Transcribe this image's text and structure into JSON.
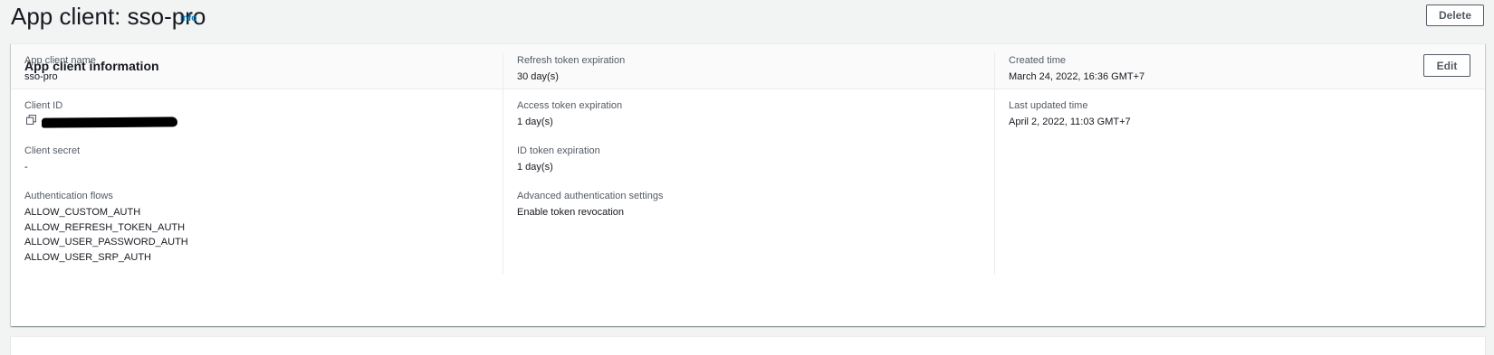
{
  "header": {
    "title": "App client: sso-pro",
    "info_label": "Info",
    "delete_label": "Delete"
  },
  "panel": {
    "title": "App client information",
    "edit_label": "Edit",
    "col1": {
      "app_client_name_label": "App client name",
      "app_client_name": "sso-pro",
      "client_id_label": "Client ID",
      "client_secret_label": "Client secret",
      "client_secret": "-",
      "auth_flows_label": "Authentication flows",
      "auth_flows": [
        "ALLOW_CUSTOM_AUTH",
        "ALLOW_REFRESH_TOKEN_AUTH",
        "ALLOW_USER_PASSWORD_AUTH",
        "ALLOW_USER_SRP_AUTH"
      ]
    },
    "col2": {
      "refresh_label": "Refresh token expiration",
      "refresh_value": "30 day(s)",
      "access_label": "Access token expiration",
      "access_value": "1 day(s)",
      "id_label": "ID token expiration",
      "id_value": "1 day(s)",
      "advanced_label": "Advanced authentication settings",
      "advanced_value": "Enable token revocation"
    },
    "col3": {
      "created_label": "Created time",
      "created_value": "March 24, 2022, 16:36 GMT+7",
      "updated_label": "Last updated time",
      "updated_value": "April 2, 2022, 11:03 GMT+7"
    }
  },
  "icons": {
    "copy": "copy-icon"
  }
}
